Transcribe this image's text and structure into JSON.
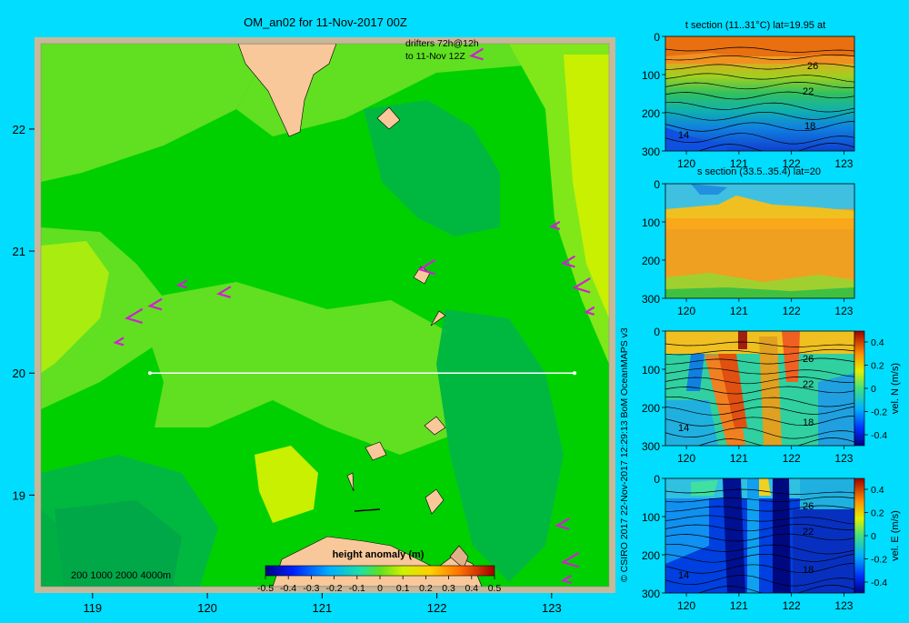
{
  "colors": {
    "background": "#00ddff",
    "frame": "#c8b89a",
    "land": "#f8c89a",
    "drifter": "#d020d0",
    "section_line": "#ffffff"
  },
  "map": {
    "title": "OM_an02 for 11-Nov-2017 00Z",
    "drifter_note_line1": "drifters 72h@12h",
    "drifter_note_line2": "to 11-Nov 12Z",
    "depth_legend": "200  1000  2000  4000m",
    "lon_ticks": [
      "119",
      "120",
      "121",
      "122",
      "123"
    ],
    "lat_ticks": [
      "22",
      "21",
      "20",
      "19"
    ],
    "xlim": [
      118.55,
      123.5
    ],
    "ylim": [
      18.25,
      22.7
    ],
    "section_lat": 20,
    "section_lon_range": [
      119.5,
      123.2
    ],
    "colorbar_label": "height anomaly (m)",
    "colorbar_ticks": [
      "-0.5",
      "-0.4",
      "-0.3",
      "-0.2",
      "-0.1",
      "0",
      "0.1",
      "0.2",
      "0.3",
      "0.4",
      "0.5"
    ]
  },
  "credit": "© CSIRO 2017   22-Nov-2017 12:29:13 BoM OceanMAPS v3",
  "chart_data": [
    {
      "type": "heatmap",
      "title": "OM_an02 for 11-Nov-2017 00Z",
      "variable": "height anomaly (m)",
      "xlim": [
        118.55,
        123.5
      ],
      "ylim": [
        18.25,
        22.7
      ],
      "value_range": [
        -0.5,
        0.5
      ],
      "drifter_positions": [
        [
          119.75,
          20.72
        ],
        [
          119.5,
          20.55
        ],
        [
          119.3,
          20.45
        ],
        [
          119.2,
          20.25
        ],
        [
          120.1,
          20.65
        ],
        [
          121.85,
          20.85
        ],
        [
          123.0,
          21.2
        ],
        [
          123.1,
          20.9
        ],
        [
          123.2,
          20.7
        ],
        [
          123.3,
          20.5
        ],
        [
          123.05,
          18.75
        ],
        [
          123.1,
          18.45
        ],
        [
          123.1,
          18.3
        ],
        [
          122.3,
          22.6
        ]
      ]
    },
    {
      "type": "heatmap",
      "title": "t section (11..31°C) lat=19.95 at",
      "xlim": [
        119.6,
        123.2
      ],
      "ylim": [
        300,
        0
      ],
      "x_ticks": [
        "120",
        "121",
        "122",
        "123"
      ],
      "y_ticks": [
        "0",
        "100",
        "200",
        "300"
      ],
      "contour_labels": [
        "26",
        "22",
        "18",
        "14"
      ],
      "value_range": [
        11,
        31
      ]
    },
    {
      "type": "heatmap",
      "title": "s section (33.5..35.4) lat=20",
      "xlim": [
        119.6,
        123.2
      ],
      "ylim": [
        300,
        0
      ],
      "x_ticks": [
        "120",
        "121",
        "122",
        "123"
      ],
      "y_ticks": [
        "0",
        "100",
        "200",
        "300"
      ],
      "value_range": [
        33.5,
        35.4
      ]
    },
    {
      "type": "heatmap",
      "xlim": [
        119.6,
        123.2
      ],
      "ylim": [
        300,
        0
      ],
      "x_ticks": [
        "120",
        "121",
        "122",
        "123"
      ],
      "y_ticks": [
        "0",
        "100",
        "200",
        "300"
      ],
      "contour_labels": [
        "26",
        "22",
        "18",
        "14"
      ],
      "colorbar_label": "vel. N (m/s)",
      "colorbar_ticks": [
        "0.4",
        "0.2",
        "0",
        "-0.2",
        "-0.4"
      ],
      "value_range": [
        -0.4,
        0.4
      ]
    },
    {
      "type": "heatmap",
      "xlim": [
        119.6,
        123.2
      ],
      "ylim": [
        300,
        0
      ],
      "x_ticks": [
        "120",
        "121",
        "122",
        "123"
      ],
      "y_ticks": [
        "0",
        "100",
        "200",
        "300"
      ],
      "contour_labels": [
        "26",
        "22",
        "18",
        "14"
      ],
      "colorbar_label": "vel. E (m/s)",
      "colorbar_ticks": [
        "0.4",
        "0.2",
        "0",
        "-0.2",
        "-0.4"
      ],
      "value_range": [
        -0.4,
        0.4
      ]
    }
  ]
}
